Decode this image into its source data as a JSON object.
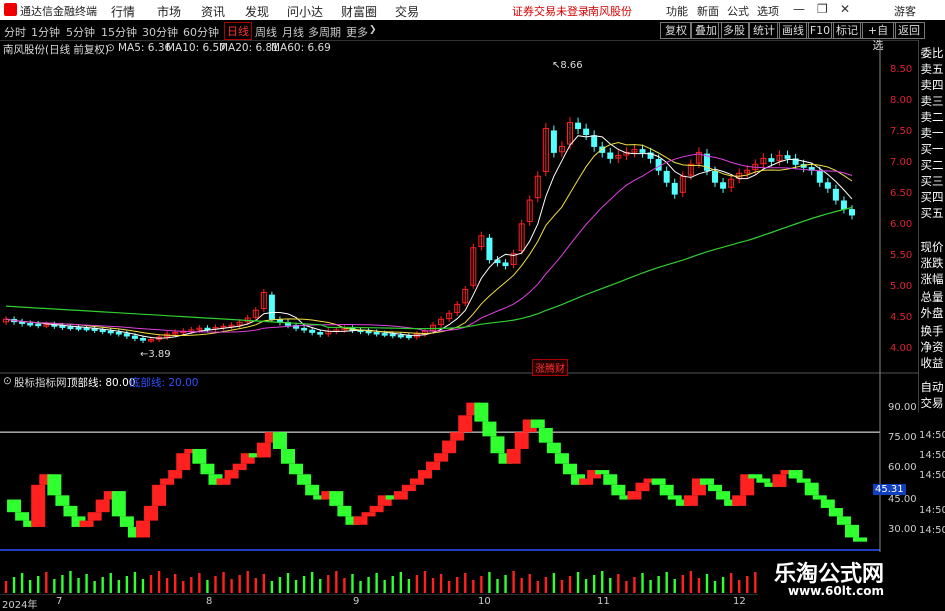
{
  "titlebar": {
    "app": "通达信金融终端",
    "menus": [
      "行情",
      "市场",
      "资讯",
      "发现",
      "问小达",
      "财富圈",
      "交易"
    ],
    "warning": "证券交易未登录",
    "stock_tab": "南风股份",
    "sys": [
      "功能",
      "新面",
      "公式",
      "选项"
    ],
    "user": "游客"
  },
  "toolbar": {
    "periods": [
      "分时",
      "1分钟",
      "5分钟",
      "15分钟",
      "30分钟",
      "60分钟",
      "日线",
      "周线",
      "月线",
      "多周期",
      "更多"
    ],
    "active_period": "日线",
    "right_buttons": [
      "复权",
      "叠加",
      "多股",
      "统计",
      "画线",
      "F10",
      "标记",
      "+自选",
      "返回"
    ]
  },
  "main_chart": {
    "stock_label": "南风股份(日线 前复权)",
    "ma": [
      {
        "label": "MA5: 6.36",
        "color": "#ffffff"
      },
      {
        "label": "MA10: 6.57",
        "color": "#f0e040"
      },
      {
        "label": "MA20: 6.81",
        "color": "#e040e0"
      },
      {
        "label": "MA60: 6.69",
        "color": "#30d030"
      }
    ],
    "high_label": "8.66",
    "low_label": "3.89",
    "event_label": "涨腾财",
    "y_ticks": [
      "8.50",
      "8.00",
      "7.50",
      "7.00",
      "6.50",
      "6.00",
      "5.50",
      "5.00",
      "4.50",
      "4.00"
    ]
  },
  "indicator": {
    "label": "股标指标网",
    "top_line": "顶部线: 80.00",
    "bottom_line": "底部线: 20.00",
    "y_ticks": [
      "90.00",
      "75.00",
      "60.00",
      "45.00",
      "30.00"
    ],
    "current_tag": "45.31",
    "times": [
      "14:50",
      "14:50",
      "14:50",
      "14:50",
      "14:50"
    ]
  },
  "x_axis": {
    "year_label": "2024年",
    "months": [
      "7",
      "8",
      "9",
      "10",
      "11",
      "12"
    ]
  },
  "right_panel": [
    "委比",
    "卖五",
    "卖四",
    "卖三",
    "卖二",
    "卖一",
    "买一",
    "买二",
    "买三",
    "买四",
    "买五",
    "现价",
    "涨跌",
    "涨幅",
    "总量",
    "外盘",
    "换手",
    "净资",
    "收益",
    "自动",
    "交易"
  ],
  "watermark": {
    "title": "乐淘公式网",
    "url": "www.60lt.com"
  },
  "colors": {
    "up": "#ff2020",
    "down": "#30ff30",
    "ma5": "#ffffff",
    "ma10": "#f0e040",
    "ma20": "#e040e0",
    "ma60": "#30d030",
    "accent": "#d40000"
  },
  "chart_data": {
    "type": "candlestick",
    "close": [
      4.4,
      4.36,
      4.33,
      4.32,
      4.3,
      4.31,
      4.29,
      4.27,
      4.26,
      4.25,
      4.24,
      4.22,
      4.2,
      4.18,
      4.16,
      4.12,
      4.08,
      4.05,
      4.06,
      4.1,
      4.15,
      4.18,
      4.2,
      4.22,
      4.25,
      4.24,
      4.26,
      4.28,
      4.3,
      4.35,
      4.42,
      4.55,
      4.85,
      4.4,
      4.35,
      4.3,
      4.25,
      4.22,
      4.18,
      4.15,
      4.2,
      4.22,
      4.25,
      4.22,
      4.2,
      4.18,
      4.16,
      4.15,
      4.13,
      4.12,
      4.1,
      4.15,
      4.2,
      4.3,
      4.4,
      4.5,
      4.65,
      4.9,
      5.6,
      5.8,
      5.4,
      5.35,
      5.3,
      5.5,
      6.0,
      6.4,
      6.8,
      7.6,
      7.2,
      7.3,
      7.7,
      7.6,
      7.5,
      7.3,
      7.2,
      7.1,
      7.15,
      7.2,
      7.25,
      7.2,
      7.1,
      6.9,
      6.7,
      6.5,
      6.8,
      7.0,
      7.2,
      6.9,
      6.7,
      6.6,
      6.75,
      6.85,
      6.9,
      7.0,
      7.1,
      7.05,
      7.15,
      7.1,
      7.0,
      6.95,
      6.9,
      6.7,
      6.6,
      6.4,
      6.25,
      6.15
    ],
    "y_range": [
      3.75,
      8.75
    ],
    "ma5": 6.36,
    "ma10": 6.57,
    "ma20": 6.81,
    "ma60": 6.69,
    "indicator_values": [
      48,
      42,
      38,
      35,
      55,
      60,
      50,
      45,
      40,
      35,
      38,
      42,
      48,
      52,
      40,
      35,
      30,
      38,
      45,
      55,
      58,
      62,
      70,
      72,
      65,
      60,
      55,
      58,
      62,
      65,
      70,
      68,
      75,
      80,
      72,
      65,
      60,
      55,
      50,
      48,
      52,
      45,
      40,
      36,
      40,
      42,
      45,
      50,
      48,
      52,
      55,
      58,
      62,
      66,
      70,
      76,
      80,
      88,
      94,
      85,
      78,
      70,
      65,
      72,
      80,
      86,
      82,
      75,
      70,
      65,
      60,
      55,
      58,
      62,
      60,
      55,
      50,
      48,
      52,
      56,
      58,
      55,
      50,
      48,
      45,
      50,
      58,
      55,
      52,
      48,
      45,
      50,
      60,
      58,
      56,
      54,
      60,
      62,
      58,
      56,
      50,
      48,
      44,
      40,
      36,
      30,
      28
    ],
    "indicator_range": [
      25,
      100
    ],
    "top_line": 80,
    "bottom_line": 20
  }
}
